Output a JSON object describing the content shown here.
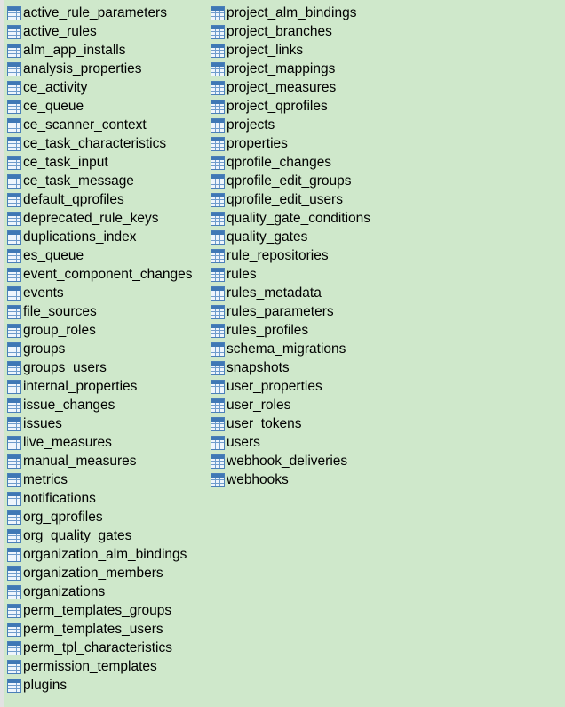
{
  "columns": [
    [
      "active_rule_parameters",
      "active_rules",
      "alm_app_installs",
      "analysis_properties",
      "ce_activity",
      "ce_queue",
      "ce_scanner_context",
      "ce_task_characteristics",
      "ce_task_input",
      "ce_task_message",
      "default_qprofiles",
      "deprecated_rule_keys",
      "duplications_index",
      "es_queue",
      "event_component_changes",
      "events",
      "file_sources",
      "group_roles",
      "groups",
      "groups_users",
      "internal_properties",
      "issue_changes",
      "issues",
      "live_measures",
      "manual_measures",
      "metrics",
      "notifications",
      "org_qprofiles",
      "org_quality_gates",
      "organization_alm_bindings",
      "organization_members",
      "organizations",
      "perm_templates_groups",
      "perm_templates_users",
      "perm_tpl_characteristics",
      "permission_templates",
      "plugins"
    ],
    [
      "project_alm_bindings",
      "project_branches",
      "project_links",
      "project_mappings",
      "project_measures",
      "project_qprofiles",
      "projects",
      "properties",
      "qprofile_changes",
      "qprofile_edit_groups",
      "qprofile_edit_users",
      "quality_gate_conditions",
      "quality_gates",
      "rule_repositories",
      "rules",
      "rules_metadata",
      "rules_parameters",
      "rules_profiles",
      "schema_migrations",
      "snapshots",
      "user_properties",
      "user_roles",
      "user_tokens",
      "users",
      "webhook_deliveries",
      "webhooks"
    ]
  ],
  "icon": "table-icon",
  "colors": {
    "background": "#cfe8cb"
  }
}
